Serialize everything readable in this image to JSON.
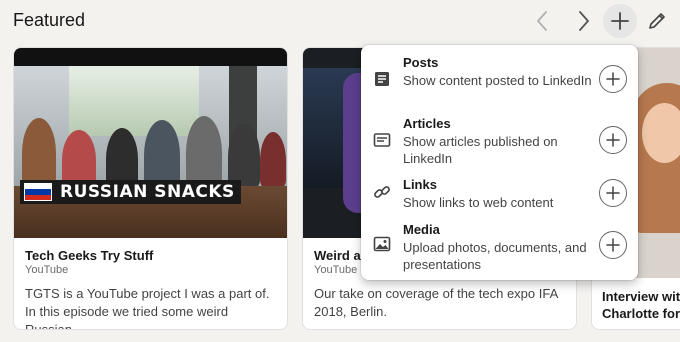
{
  "header": {
    "title": "Featured",
    "prev_icon": "chevron-left-icon",
    "next_icon": "chevron-right-icon",
    "add_icon": "plus-icon",
    "edit_icon": "pencil-icon"
  },
  "cards": [
    {
      "title": "Tech Geeks Try Stuff",
      "source": "YouTube",
      "description": "TGTS is a YouTube project I was a part of. In this episode we tried some weird Russian…",
      "thumbnail_caption": "RUSSIAN SNACKS"
    },
    {
      "title": "Weird an",
      "source": "YouTube",
      "description": "Our take on coverage of the tech expo IFA 2018, Berlin."
    },
    {
      "title_line1": "Interview with",
      "title_line2": "Charlotte for"
    }
  ],
  "add_menu": {
    "items": [
      {
        "label": "Posts",
        "description": "Show content posted to LinkedIn",
        "icon": "document-icon"
      },
      {
        "label": "Articles",
        "description": "Show articles published on LinkedIn",
        "icon": "article-icon"
      },
      {
        "label": "Links",
        "description": "Show links to web content",
        "icon": "link-icon"
      },
      {
        "label": "Media",
        "description": "Upload photos, documents, and presentations",
        "icon": "image-icon"
      }
    ]
  },
  "colors": {
    "background": "#f3f2ef",
    "card": "#ffffff",
    "flag_white": "#ffffff",
    "flag_blue": "#0039a6",
    "flag_red": "#d52b1e"
  }
}
